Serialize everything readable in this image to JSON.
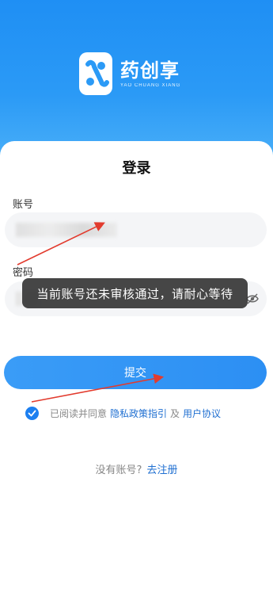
{
  "app": {
    "brand_name": "药创享",
    "brand_subtitle": "YAO CHUANG XIANG"
  },
  "login": {
    "title": "登录",
    "account_label": "账号",
    "password_label": "密码",
    "submit_label": "提交"
  },
  "toast": {
    "message": "当前账号还未审核通过，请耐心等待"
  },
  "agreement": {
    "checked": true,
    "prefix": "已阅读并同意",
    "privacy_link": "隐私政策指引",
    "and": "及",
    "user_link": "用户协议"
  },
  "register": {
    "question": "没有账号?",
    "link": "去注册"
  },
  "colors": {
    "brand_blue": "#2b9af6",
    "link_blue": "#1f6fd1",
    "annotation_red": "#e23b2e"
  },
  "icons": {
    "logo": "logo-icon",
    "password_toggle": "eye-slash-icon",
    "checkbox": "check-icon"
  }
}
